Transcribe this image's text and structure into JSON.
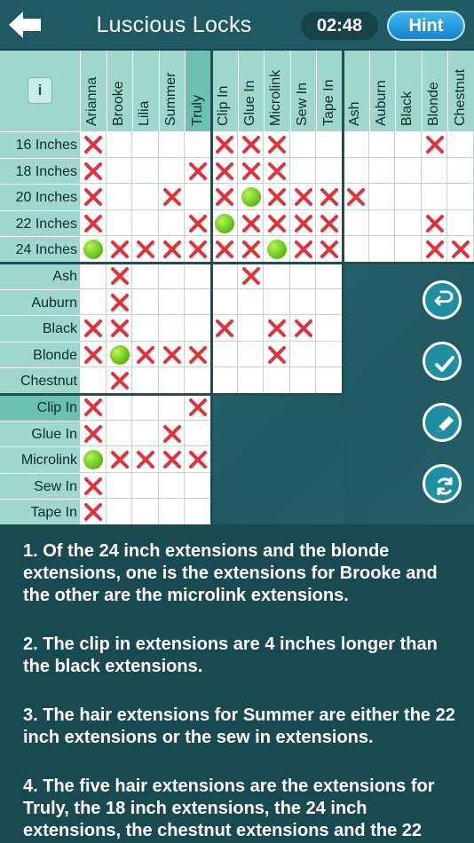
{
  "header": {
    "title": "Luscious Locks",
    "timer": "02:48",
    "hint_label": "Hint",
    "info_label": "i"
  },
  "columns": {
    "names": [
      "Arianna",
      "Brooke",
      "Lilia",
      "Summer",
      "Truly"
    ],
    "styles": [
      "Clip In",
      "Glue In",
      "Microlink",
      "Sew In",
      "Tape In"
    ],
    "colors": [
      "Ash",
      "Auburn",
      "Black",
      "Blonde",
      "Chestnut"
    ],
    "selected": "Truly"
  },
  "rows": {
    "lengths": [
      "16 Inches",
      "18 Inches",
      "20 Inches",
      "22 Inches",
      "24 Inches"
    ],
    "colors": [
      "Ash",
      "Auburn",
      "Black",
      "Blonde",
      "Chestnut"
    ],
    "styles": [
      "Clip In",
      "Glue In",
      "Microlink",
      "Sew In",
      "Tape In"
    ],
    "selected": "Clip In"
  },
  "marks": {
    "lengths_names": [
      "X....",
      "X...X",
      "X..X.",
      "X...X",
      "OXXXX"
    ],
    "lengths_styles": [
      "XXX..",
      "XXX..",
      "XOXXX",
      "OXXXX",
      "XXOXX"
    ],
    "lengths_colors": [
      "...X.",
      ".....",
      "X....",
      "...X.",
      "...XX"
    ],
    "colors_names": [
      ".X...",
      ".X...",
      "XX...",
      "XOXXX",
      ".X..."
    ],
    "colors_styles": [
      ".X...",
      ".....",
      "X.XX.",
      "..X..",
      "....."
    ],
    "styles_names": [
      "X...X",
      "X..X.",
      "OXXXX",
      "X....",
      "X...."
    ]
  },
  "clues": [
    "1. Of the 24 inch extensions and the blonde extensions, one is the extensions for Brooke and the other are the microlink extensions.",
    "2. The clip in extensions are 4 inches longer than the black extensions.",
    "3. The hair extensions for Summer are either the 22 inch extensions or the sew in extensions.",
    "4. The five hair extensions are the extensions for Truly, the 18 inch extensions, the 24 inch extensions, the chestnut extensions and the 22"
  ],
  "side_buttons": [
    "undo-icon",
    "check-icon",
    "pencil-icon",
    "refresh-icon"
  ],
  "colors_theme": {
    "header_bg": "#1f5a62",
    "grid_header": "#9fd7cd",
    "mark_x": "#e0333c",
    "mark_o": "#6cc417",
    "hint_blue": "#1e96dc"
  }
}
